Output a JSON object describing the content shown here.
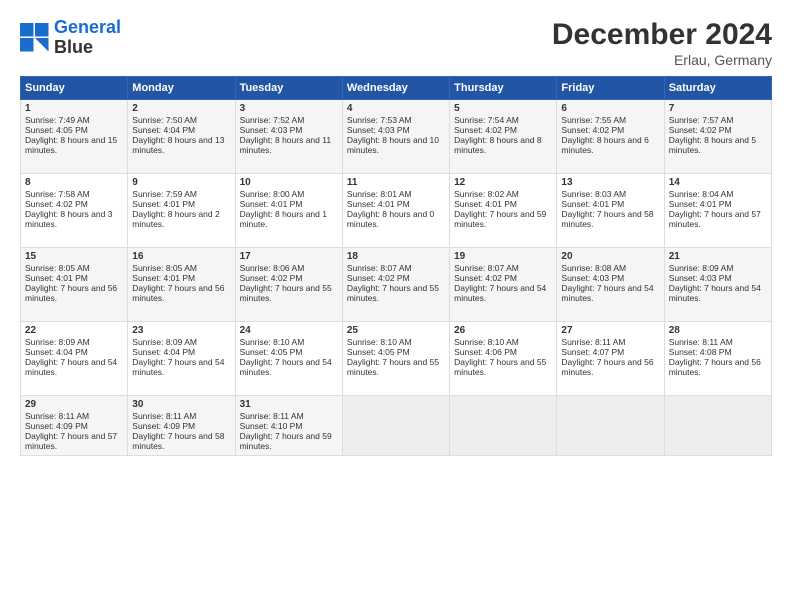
{
  "header": {
    "logo_line1": "General",
    "logo_line2": "Blue",
    "month": "December 2024",
    "location": "Erlau, Germany"
  },
  "days_of_week": [
    "Sunday",
    "Monday",
    "Tuesday",
    "Wednesday",
    "Thursday",
    "Friday",
    "Saturday"
  ],
  "weeks": [
    [
      {
        "day": 1,
        "sunrise": "Sunrise: 7:49 AM",
        "sunset": "Sunset: 4:05 PM",
        "daylight": "Daylight: 8 hours and 15 minutes."
      },
      {
        "day": 2,
        "sunrise": "Sunrise: 7:50 AM",
        "sunset": "Sunset: 4:04 PM",
        "daylight": "Daylight: 8 hours and 13 minutes."
      },
      {
        "day": 3,
        "sunrise": "Sunrise: 7:52 AM",
        "sunset": "Sunset: 4:03 PM",
        "daylight": "Daylight: 8 hours and 11 minutes."
      },
      {
        "day": 4,
        "sunrise": "Sunrise: 7:53 AM",
        "sunset": "Sunset: 4:03 PM",
        "daylight": "Daylight: 8 hours and 10 minutes."
      },
      {
        "day": 5,
        "sunrise": "Sunrise: 7:54 AM",
        "sunset": "Sunset: 4:02 PM",
        "daylight": "Daylight: 8 hours and 8 minutes."
      },
      {
        "day": 6,
        "sunrise": "Sunrise: 7:55 AM",
        "sunset": "Sunset: 4:02 PM",
        "daylight": "Daylight: 8 hours and 6 minutes."
      },
      {
        "day": 7,
        "sunrise": "Sunrise: 7:57 AM",
        "sunset": "Sunset: 4:02 PM",
        "daylight": "Daylight: 8 hours and 5 minutes."
      }
    ],
    [
      {
        "day": 8,
        "sunrise": "Sunrise: 7:58 AM",
        "sunset": "Sunset: 4:02 PM",
        "daylight": "Daylight: 8 hours and 3 minutes."
      },
      {
        "day": 9,
        "sunrise": "Sunrise: 7:59 AM",
        "sunset": "Sunset: 4:01 PM",
        "daylight": "Daylight: 8 hours and 2 minutes."
      },
      {
        "day": 10,
        "sunrise": "Sunrise: 8:00 AM",
        "sunset": "Sunset: 4:01 PM",
        "daylight": "Daylight: 8 hours and 1 minute."
      },
      {
        "day": 11,
        "sunrise": "Sunrise: 8:01 AM",
        "sunset": "Sunset: 4:01 PM",
        "daylight": "Daylight: 8 hours and 0 minutes."
      },
      {
        "day": 12,
        "sunrise": "Sunrise: 8:02 AM",
        "sunset": "Sunset: 4:01 PM",
        "daylight": "Daylight: 7 hours and 59 minutes."
      },
      {
        "day": 13,
        "sunrise": "Sunrise: 8:03 AM",
        "sunset": "Sunset: 4:01 PM",
        "daylight": "Daylight: 7 hours and 58 minutes."
      },
      {
        "day": 14,
        "sunrise": "Sunrise: 8:04 AM",
        "sunset": "Sunset: 4:01 PM",
        "daylight": "Daylight: 7 hours and 57 minutes."
      }
    ],
    [
      {
        "day": 15,
        "sunrise": "Sunrise: 8:05 AM",
        "sunset": "Sunset: 4:01 PM",
        "daylight": "Daylight: 7 hours and 56 minutes."
      },
      {
        "day": 16,
        "sunrise": "Sunrise: 8:05 AM",
        "sunset": "Sunset: 4:01 PM",
        "daylight": "Daylight: 7 hours and 56 minutes."
      },
      {
        "day": 17,
        "sunrise": "Sunrise: 8:06 AM",
        "sunset": "Sunset: 4:02 PM",
        "daylight": "Daylight: 7 hours and 55 minutes."
      },
      {
        "day": 18,
        "sunrise": "Sunrise: 8:07 AM",
        "sunset": "Sunset: 4:02 PM",
        "daylight": "Daylight: 7 hours and 55 minutes."
      },
      {
        "day": 19,
        "sunrise": "Sunrise: 8:07 AM",
        "sunset": "Sunset: 4:02 PM",
        "daylight": "Daylight: 7 hours and 54 minutes."
      },
      {
        "day": 20,
        "sunrise": "Sunrise: 8:08 AM",
        "sunset": "Sunset: 4:03 PM",
        "daylight": "Daylight: 7 hours and 54 minutes."
      },
      {
        "day": 21,
        "sunrise": "Sunrise: 8:09 AM",
        "sunset": "Sunset: 4:03 PM",
        "daylight": "Daylight: 7 hours and 54 minutes."
      }
    ],
    [
      {
        "day": 22,
        "sunrise": "Sunrise: 8:09 AM",
        "sunset": "Sunset: 4:04 PM",
        "daylight": "Daylight: 7 hours and 54 minutes."
      },
      {
        "day": 23,
        "sunrise": "Sunrise: 8:09 AM",
        "sunset": "Sunset: 4:04 PM",
        "daylight": "Daylight: 7 hours and 54 minutes."
      },
      {
        "day": 24,
        "sunrise": "Sunrise: 8:10 AM",
        "sunset": "Sunset: 4:05 PM",
        "daylight": "Daylight: 7 hours and 54 minutes."
      },
      {
        "day": 25,
        "sunrise": "Sunrise: 8:10 AM",
        "sunset": "Sunset: 4:05 PM",
        "daylight": "Daylight: 7 hours and 55 minutes."
      },
      {
        "day": 26,
        "sunrise": "Sunrise: 8:10 AM",
        "sunset": "Sunset: 4:06 PM",
        "daylight": "Daylight: 7 hours and 55 minutes."
      },
      {
        "day": 27,
        "sunrise": "Sunrise: 8:11 AM",
        "sunset": "Sunset: 4:07 PM",
        "daylight": "Daylight: 7 hours and 56 minutes."
      },
      {
        "day": 28,
        "sunrise": "Sunrise: 8:11 AM",
        "sunset": "Sunset: 4:08 PM",
        "daylight": "Daylight: 7 hours and 56 minutes."
      }
    ],
    [
      {
        "day": 29,
        "sunrise": "Sunrise: 8:11 AM",
        "sunset": "Sunset: 4:09 PM",
        "daylight": "Daylight: 7 hours and 57 minutes."
      },
      {
        "day": 30,
        "sunrise": "Sunrise: 8:11 AM",
        "sunset": "Sunset: 4:09 PM",
        "daylight": "Daylight: 7 hours and 58 minutes."
      },
      {
        "day": 31,
        "sunrise": "Sunrise: 8:11 AM",
        "sunset": "Sunset: 4:10 PM",
        "daylight": "Daylight: 7 hours and 59 minutes."
      },
      null,
      null,
      null,
      null
    ]
  ]
}
